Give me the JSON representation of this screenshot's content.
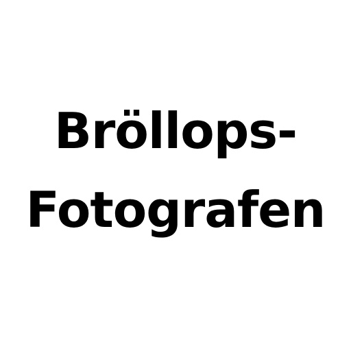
{
  "text": {
    "line1": "Bröllops-",
    "line2": "Fotografen"
  },
  "colors": {
    "background": "#ffffff",
    "text": "#000000"
  }
}
